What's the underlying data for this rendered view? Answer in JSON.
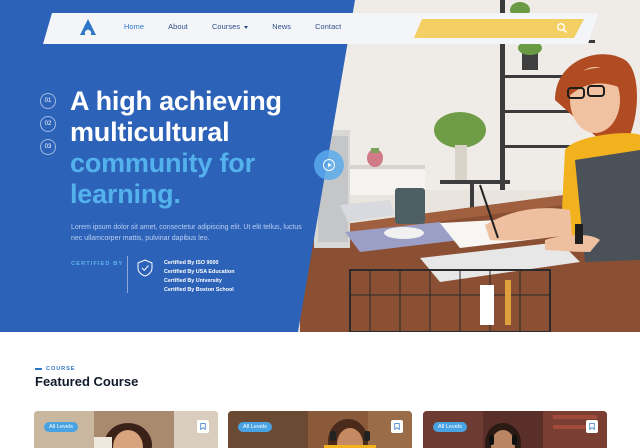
{
  "nav": {
    "links": [
      "Home",
      "About",
      "Courses",
      "News",
      "Contact"
    ],
    "active": "Home",
    "search_placeholder": ""
  },
  "hero": {
    "slides": [
      "01",
      "02",
      "03"
    ],
    "headline_white": [
      "A high achieving",
      "multicultural"
    ],
    "headline_blue": [
      "community for",
      "learning."
    ],
    "description": "Lorem ipsum dolor sit amet, consectetur adipiscing elit. Ut elit tellus, luctus nec ullamcorper mattis, pulvinar dapibus leo.",
    "certified_label": "CERTIFIED BY",
    "certifications": [
      "Certified By ISO 9000",
      "Certified By USA Education",
      "Certified By University",
      "Certified By Boston School"
    ]
  },
  "featured": {
    "eyebrow": "COURSE",
    "title": "Featured Course",
    "cards": [
      {
        "badge": "All Levels"
      },
      {
        "badge": "All Levels"
      },
      {
        "badge": "All Levels"
      }
    ]
  },
  "colors": {
    "brand_blue": "#2d62b9",
    "accent_light_blue": "#53b2ec",
    "search_yellow": "#f4cf63",
    "badge_blue": "#49a3e3"
  },
  "icons": [
    "logo-icon",
    "search-icon",
    "play-icon",
    "shield-icon",
    "bookmark-icon"
  ]
}
